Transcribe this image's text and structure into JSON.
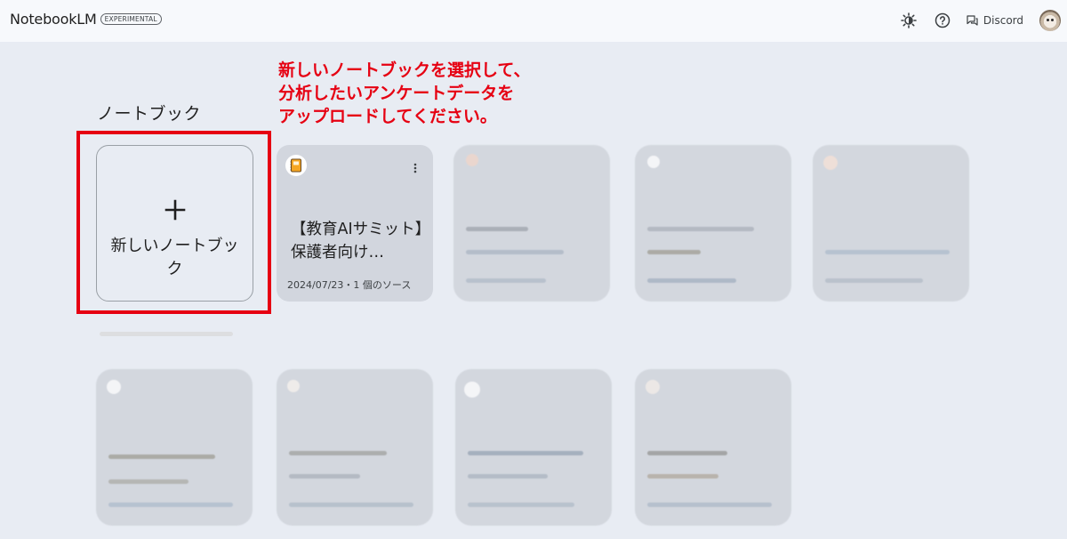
{
  "app": {
    "name": "NotebookLM",
    "badge": "EXPERIMENTAL"
  },
  "topbar": {
    "theme_icon": "brightness-icon",
    "help_icon": "help-circle-icon",
    "discord_label": "Discord",
    "avatar": "user-avatar"
  },
  "annotation": {
    "lines": [
      "新しいノートブックを選択して、",
      "分析したいアンケートデータを",
      "アップロードしてください。"
    ],
    "color": "#e60012"
  },
  "section_title": "ノートブック",
  "new_notebook": {
    "label": "新しいノートブック",
    "icon": "plus-icon"
  },
  "notebooks": [
    {
      "emoji_icon": "notebook-emoji-icon",
      "title": "【教育AIサミット】保護者向け…",
      "meta": "2024/07/23・1 個のソース",
      "menu_icon": "more-vert-icon"
    }
  ],
  "colors": {
    "background": "#e8ecf3",
    "topbar": "#f7f9fc",
    "card": "#d2d6de",
    "highlight": "#e60012"
  }
}
